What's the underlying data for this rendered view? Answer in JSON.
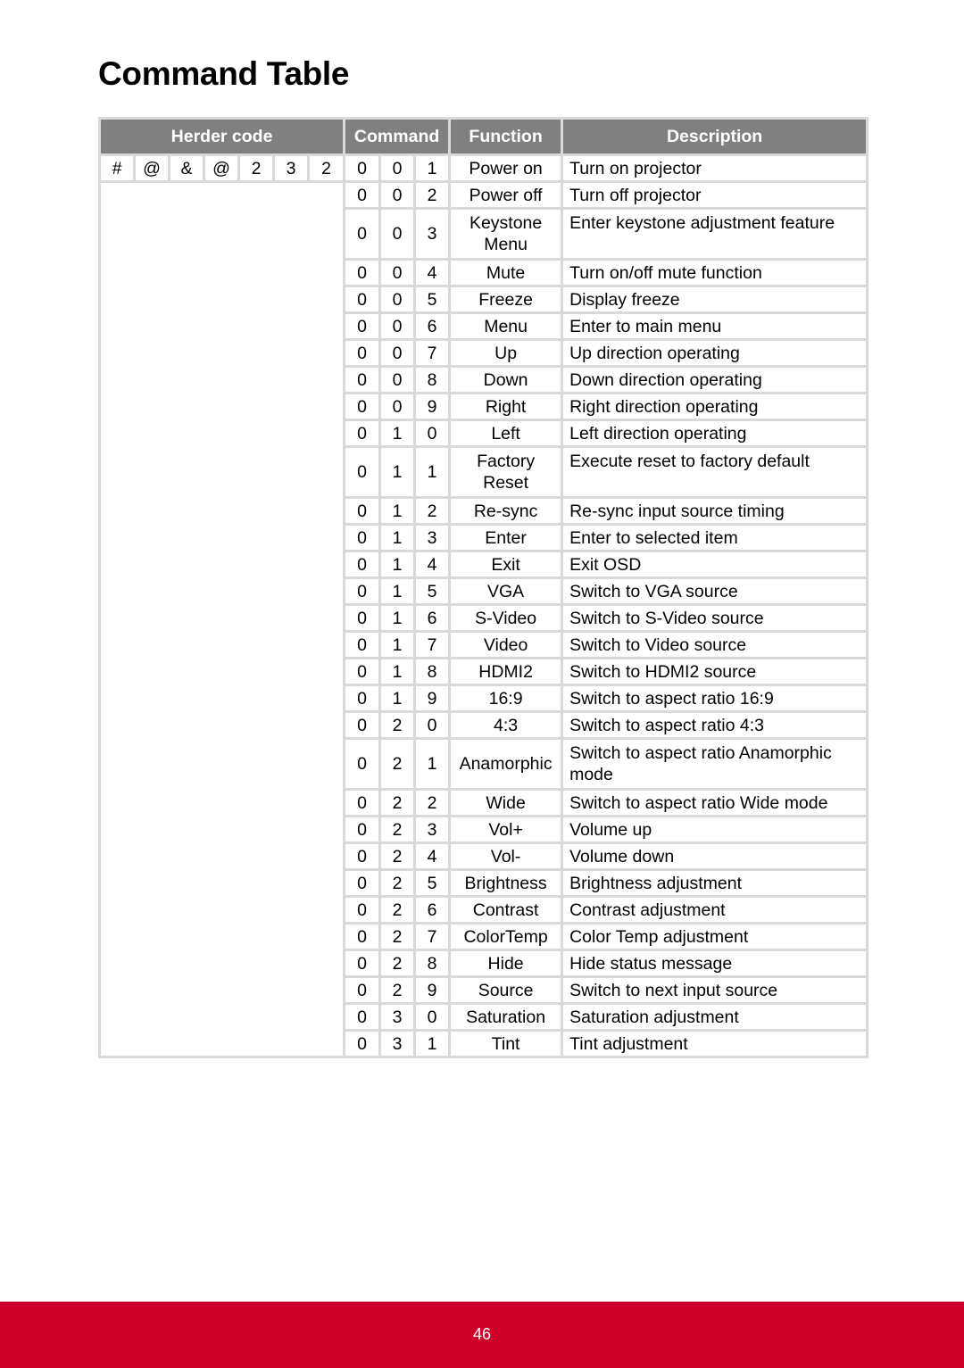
{
  "page": {
    "title": "Command Table",
    "page_number": "46",
    "footer_color": "#ce002b",
    "header_color": "#808080"
  },
  "table": {
    "headers": {
      "header_code": "Herder code",
      "command": "Command",
      "function": "Function",
      "description": "Description"
    },
    "header_code_chars": [
      "#",
      "@",
      "&",
      "@",
      "2",
      "3",
      "2"
    ],
    "rows": [
      {
        "cmd": [
          "0",
          "0",
          "1"
        ],
        "function": "Power on",
        "description": "Turn on projector"
      },
      {
        "cmd": [
          "0",
          "0",
          "2"
        ],
        "function": "Power off",
        "description": "Turn off projector"
      },
      {
        "cmd": [
          "0",
          "0",
          "3"
        ],
        "function": "Keystone Menu",
        "description": "Enter keystone adjustment feature",
        "tall": true
      },
      {
        "cmd": [
          "0",
          "0",
          "4"
        ],
        "function": "Mute",
        "description": "Turn on/off mute function"
      },
      {
        "cmd": [
          "0",
          "0",
          "5"
        ],
        "function": "Freeze",
        "description": "Display freeze"
      },
      {
        "cmd": [
          "0",
          "0",
          "6"
        ],
        "function": "Menu",
        "description": "Enter to main menu"
      },
      {
        "cmd": [
          "0",
          "0",
          "7"
        ],
        "function": "Up",
        "description": "Up direction operating"
      },
      {
        "cmd": [
          "0",
          "0",
          "8"
        ],
        "function": "Down",
        "description": "Down direction operating"
      },
      {
        "cmd": [
          "0",
          "0",
          "9"
        ],
        "function": "Right",
        "description": "Right direction operating"
      },
      {
        "cmd": [
          "0",
          "1",
          "0"
        ],
        "function": "Left",
        "description": "Left direction operating"
      },
      {
        "cmd": [
          "0",
          "1",
          "1"
        ],
        "function": "Factory Reset",
        "description": "Execute reset to factory default",
        "tall": true
      },
      {
        "cmd": [
          "0",
          "1",
          "2"
        ],
        "function": "Re-sync",
        "description": "Re-sync input source timing"
      },
      {
        "cmd": [
          "0",
          "1",
          "3"
        ],
        "function": "Enter",
        "description": "Enter to selected item"
      },
      {
        "cmd": [
          "0",
          "1",
          "4"
        ],
        "function": "Exit",
        "description": "Exit OSD"
      },
      {
        "cmd": [
          "0",
          "1",
          "5"
        ],
        "function": "VGA",
        "description": "Switch to VGA source"
      },
      {
        "cmd": [
          "0",
          "1",
          "6"
        ],
        "function": "S-Video",
        "description": "Switch to S-Video source"
      },
      {
        "cmd": [
          "0",
          "1",
          "7"
        ],
        "function": "Video",
        "description": "Switch to Video source"
      },
      {
        "cmd": [
          "0",
          "1",
          "8"
        ],
        "function": "HDMI2",
        "description": "Switch to HDMI2 source"
      },
      {
        "cmd": [
          "0",
          "1",
          "9"
        ],
        "function": "16:9",
        "description": "Switch to aspect ratio 16:9"
      },
      {
        "cmd": [
          "0",
          "2",
          "0"
        ],
        "function": "4:3",
        "description": "Switch to aspect ratio 4:3"
      },
      {
        "cmd": [
          "0",
          "2",
          "1"
        ],
        "function": "Anamorphic",
        "description": "Switch to aspect ratio Anamorphic mode",
        "tall": true
      },
      {
        "cmd": [
          "0",
          "2",
          "2"
        ],
        "function": "Wide",
        "description": "Switch to aspect ratio Wide mode"
      },
      {
        "cmd": [
          "0",
          "2",
          "3"
        ],
        "function": "Vol+",
        "description": "Volume up"
      },
      {
        "cmd": [
          "0",
          "2",
          "4"
        ],
        "function": "Vol-",
        "description": "Volume down"
      },
      {
        "cmd": [
          "0",
          "2",
          "5"
        ],
        "function": "Brightness",
        "description": "Brightness adjustment"
      },
      {
        "cmd": [
          "0",
          "2",
          "6"
        ],
        "function": "Contrast",
        "description": "Contrast adjustment"
      },
      {
        "cmd": [
          "0",
          "2",
          "7"
        ],
        "function": "ColorTemp",
        "description": "Color Temp adjustment"
      },
      {
        "cmd": [
          "0",
          "2",
          "8"
        ],
        "function": "Hide",
        "description": "Hide status message"
      },
      {
        "cmd": [
          "0",
          "2",
          "9"
        ],
        "function": "Source",
        "description": "Switch to next input source"
      },
      {
        "cmd": [
          "0",
          "3",
          "0"
        ],
        "function": "Saturation",
        "description": "Saturation adjustment"
      },
      {
        "cmd": [
          "0",
          "3",
          "1"
        ],
        "function": "Tint",
        "description": "Tint adjustment"
      }
    ]
  }
}
